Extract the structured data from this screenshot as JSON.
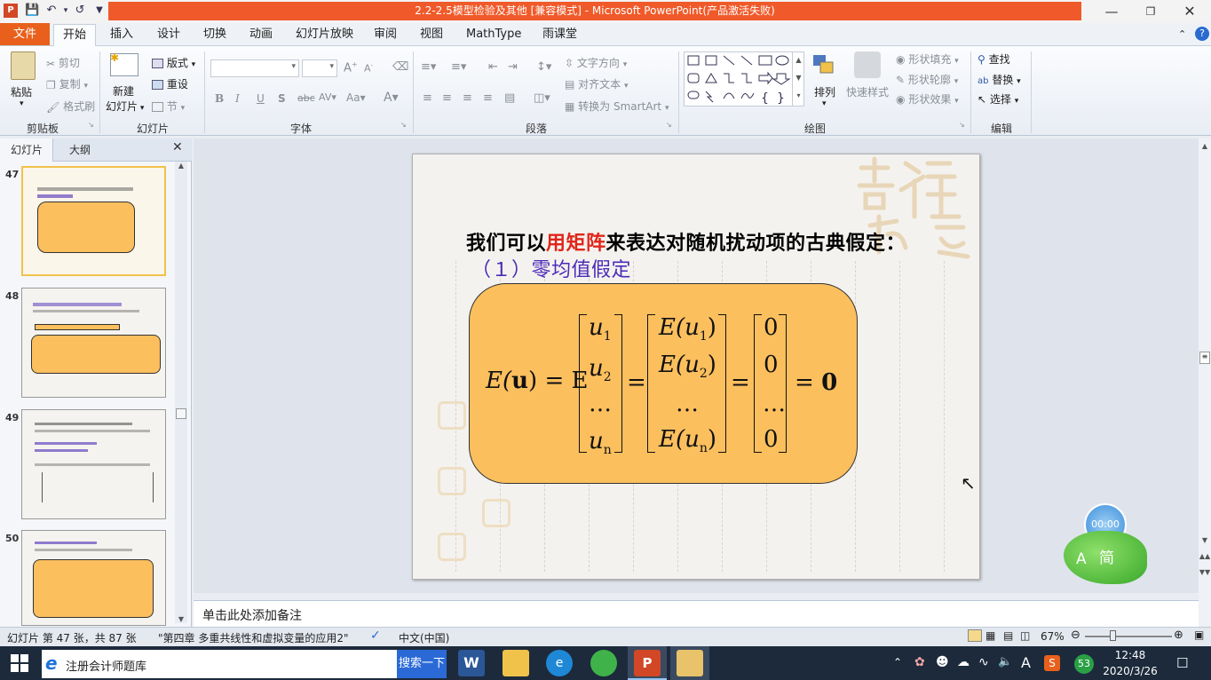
{
  "window": {
    "title": "2.2-2.5模型检验及其他 [兼容模式] - Microsoft PowerPoint(产品激活失败)",
    "accent": "#f05a2a"
  },
  "menu": {
    "file": "文件",
    "tabs": [
      "开始",
      "插入",
      "设计",
      "切换",
      "动画",
      "幻灯片放映",
      "审阅",
      "视图",
      "MathType",
      "雨课堂"
    ]
  },
  "ribbon": {
    "clipboard": {
      "paste": "粘贴",
      "cut": "剪切",
      "copy": "复制",
      "format_painter": "格式刷",
      "label": "剪贴板"
    },
    "slides": {
      "new_slide": "新建",
      "new_slide2": "幻灯片",
      "layout": "版式",
      "reset": "重设",
      "section": "节",
      "label": "幻灯片"
    },
    "font": {
      "label": "字体",
      "bold": "B",
      "italic": "I",
      "underline": "U",
      "shadow": "S",
      "strike": "abc"
    },
    "paragraph": {
      "text_direction": "文字方向",
      "align_text": "对齐文本",
      "smartart": "转换为 SmartArt",
      "label": "段落"
    },
    "drawing": {
      "arrange": "排列",
      "quick_styles": "快速样式",
      "shape_fill": "形状填充",
      "shape_outline": "形状轮廓",
      "shape_effects": "形状效果",
      "label": "绘图"
    },
    "editing": {
      "find": "查找",
      "replace": "替换",
      "select": "选择",
      "label": "编辑"
    }
  },
  "left_pane": {
    "tab_slides": "幻灯片",
    "tab_outline": "大纲",
    "thumbnails": [
      {
        "number": "47"
      },
      {
        "number": "48"
      },
      {
        "number": "49"
      },
      {
        "number": "50"
      }
    ]
  },
  "slide": {
    "title_part1": "我们可以",
    "title_highlight": "用矩阵",
    "title_part2": "来表达对随机扰动项的古典假定：",
    "subtitle": "（１）零均值假定",
    "formula": {
      "lhs": "E(",
      "lhs_bold": "u",
      "lhs_end": ") = E",
      "vec_u": [
        "u",
        "u",
        "…",
        "u"
      ],
      "vec_u_sub": [
        "1",
        "2",
        "",
        "n"
      ],
      "vec_e": [
        "E(u",
        "E(u",
        "…",
        "E(u"
      ],
      "vec_e_sub": [
        "1",
        "2",
        "",
        "n"
      ],
      "vec_zero": [
        "0",
        "0",
        "…",
        "0"
      ],
      "eq": "=",
      "rhs": "= ",
      "rhs_bold": "0"
    }
  },
  "notes": {
    "placeholder": "单击此处添加备注"
  },
  "status": {
    "slide_info": "幻灯片 第 47 张，共 87 张",
    "theme": "\"第四章 多重共线性和虚拟变量的应用2\"",
    "language": "中文(中国)",
    "zoom": "67%"
  },
  "taskbar": {
    "app_label": "注册会计师题库",
    "search_button": "搜索一下",
    "time": "12:48",
    "date": "2020/3/26",
    "badge": "53",
    "ime": "A"
  },
  "overlay": {
    "timer": "00:00",
    "widget_a": "A",
    "widget_jian": "简"
  }
}
